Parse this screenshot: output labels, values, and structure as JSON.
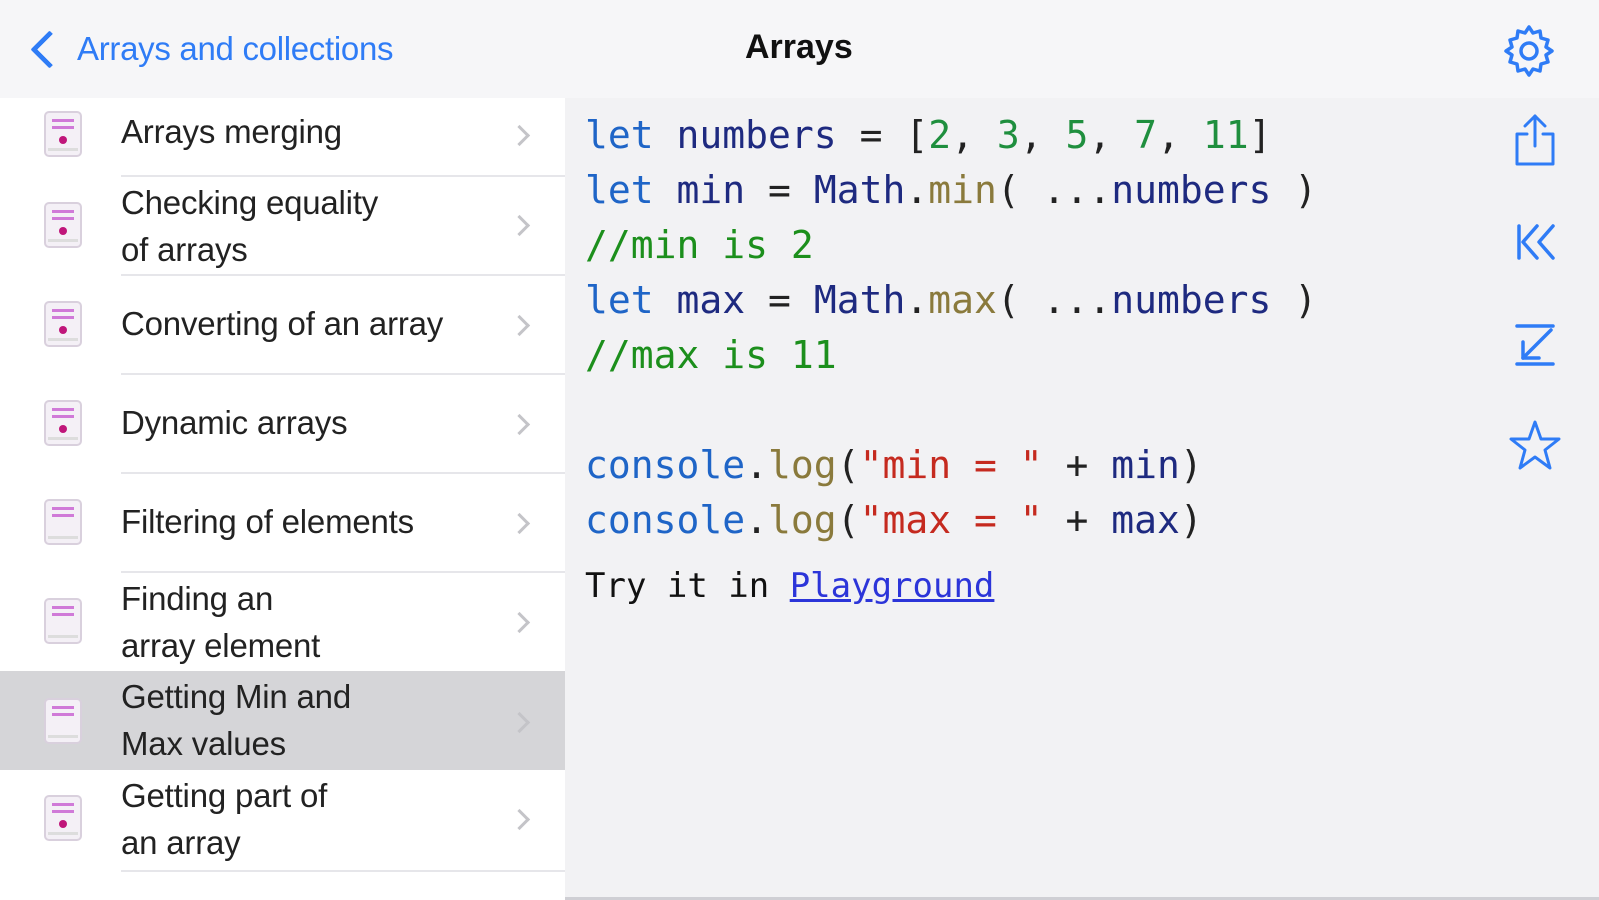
{
  "nav": {
    "back_label": "Arrays and collections",
    "title": "Arrays"
  },
  "colors": {
    "accent": "#2f7cf6",
    "selected_row": "#d5d5d8"
  },
  "list": {
    "items": [
      {
        "label_line1": "Arrays merging",
        "label_line2": ""
      },
      {
        "label_line1": "Checking equality",
        "label_line2": "of arrays"
      },
      {
        "label_line1": "Converting of an array",
        "label_line2": ""
      },
      {
        "label_line1": "Dynamic arrays",
        "label_line2": ""
      },
      {
        "label_line1": "Filtering of elements",
        "label_line2": ""
      },
      {
        "label_line1": "Finding an",
        "label_line2": "array element"
      },
      {
        "label_line1": "Getting Min and",
        "label_line2": "Max values"
      },
      {
        "label_line1": "Getting part of",
        "label_line2": "an array"
      }
    ],
    "selected_index": 6
  },
  "code": {
    "lines": [
      "let numbers = [2, 3, 5, 7, 11]",
      "let min = Math.min( ...numbers )",
      "//min is 2",
      "let max = Math.max( ...numbers )",
      "//max is 11",
      "",
      "console.log(\"min = \" + min)",
      "console.log(\"max = \" + max)"
    ],
    "try_prefix": "Try it in ",
    "try_link": "Playground"
  },
  "toolbar": {
    "icons": [
      "share-icon",
      "jump-to-start-icon",
      "jump-to-end-icon",
      "star-icon"
    ]
  }
}
